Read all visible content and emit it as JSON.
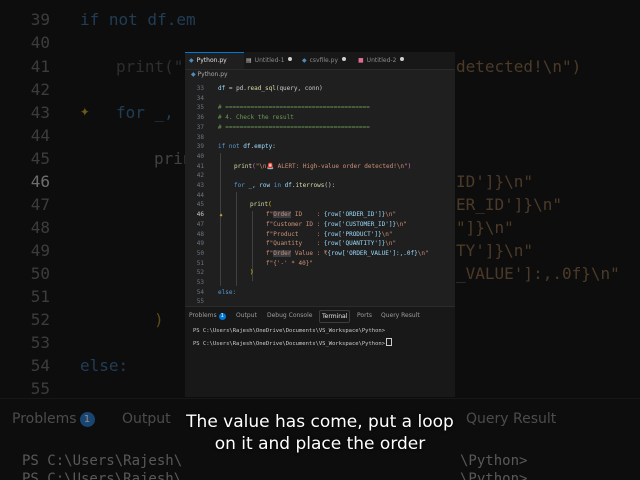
{
  "background": {
    "lines": [
      "39",
      "40",
      "41",
      "42",
      "43",
      "44",
      "45",
      "46",
      "47",
      "48",
      "49",
      "50",
      "51",
      "52",
      "53",
      "54",
      "55"
    ],
    "current_line": "46",
    "fragments": {
      "f1": "if not df.em",
      "f2": "print(\"",
      "f3": "detected!\\n\")",
      "f4": "for _, r",
      "f5": "print",
      "f6": "ID']}\\n\"",
      "f7": "ER_ID']}\\n\"",
      "f8": "\"]}\\n\"",
      "f9": "TY']}\\n\"",
      "f10": "_VALUE']:,.0f}\\n\"",
      "f11": ")",
      "f12": "else:"
    },
    "panel_tabs": {
      "problems": "Problems",
      "problems_badge": "1",
      "output": "Output",
      "query_result": "Query Result"
    },
    "ps1": "PS C:\\Users\\Rajesh\\",
    "ps1_end": "\\Python>",
    "ps2": "PS C:\\Users\\Rajesh\\",
    "ps2_end": "\\Python>"
  },
  "tabs": [
    {
      "label": "Python.py",
      "active": true
    },
    {
      "label": "Untitled-1",
      "dirty": true
    },
    {
      "label": "csvfile.py",
      "dirty": true
    },
    {
      "label": "Untitled-2",
      "dirty": true
    }
  ],
  "breadcrumb": "Python.py",
  "line_numbers": [
    "33",
    "34",
    "35",
    "36",
    "37",
    "38",
    "39",
    "40",
    "41",
    "42",
    "43",
    "44",
    "45",
    "46",
    "47",
    "48",
    "49",
    "50",
    "51",
    "52",
    "53",
    "54",
    "55"
  ],
  "current_line": "46",
  "code": {
    "l33a": "df",
    "l33b": " = pd.",
    "l33c": "read_sql",
    "l33d": "(query, conn)",
    "l35": "# ========================================",
    "l36": "# 4. Check the result",
    "l37": "# ========================================",
    "l39a": "if not",
    "l39b": " df.empty:",
    "l41a": "print",
    "l41b": "(",
    "l41c": "\"\\n🚨 ALERT: High-value order detected!\\n\"",
    "l41d": ")",
    "l43a": "for",
    "l43b": " _, row ",
    "l43c": "in",
    "l43d": " df.",
    "l43e": "iterrows",
    "l43f": "():",
    "l45a": "print",
    "l45b": "(",
    "l46a": "f\"",
    "l46b": "Order",
    "l46c": " ID    : ",
    "l46d": "{row['ORDER_ID']}",
    "l46e": "\\n\"",
    "l47a": "f\"Customer ID : ",
    "l47b": "{row['CUSTOMER_ID']}",
    "l47c": "\\n\"",
    "l48a": "f\"Product     : ",
    "l48b": "{row['PRODUCT']}",
    "l48c": "\\n\"",
    "l49a": "f\"Quantity    : ",
    "l49b": "{row['QUANTITY']}",
    "l49c": "\\n\"",
    "l50a": "f\"",
    "l50b": "Order",
    "l50c": " Value : ₹",
    "l50d": "{row['ORDER_VALUE']:,.0f}",
    "l50e": "\\n\"",
    "l51a": "f\"{'-' * 40}\"",
    "l52": ")",
    "l54": "else:"
  },
  "panel": {
    "tabs": [
      "Problems",
      "Output",
      "Debug Console",
      "Terminal",
      "Ports",
      "Query Result"
    ],
    "problems_badge": "1",
    "active_tab": "Terminal",
    "term1": "PS C:\\Users\\Rajesh\\OneDrive\\Documents\\VS_Workspace\\Python>",
    "term2": "PS C:\\Users\\Rajesh\\OneDrive\\Documents\\VS_Workspace\\Python>"
  },
  "caption": {
    "line1": "The value has come, put a loop",
    "line2": "on it and place the order"
  },
  "colors": {
    "accent": "#0078d4",
    "keyword": "#569cd6",
    "function": "#dcdcaa",
    "string": "#ce9178",
    "comment": "#6a9955"
  }
}
